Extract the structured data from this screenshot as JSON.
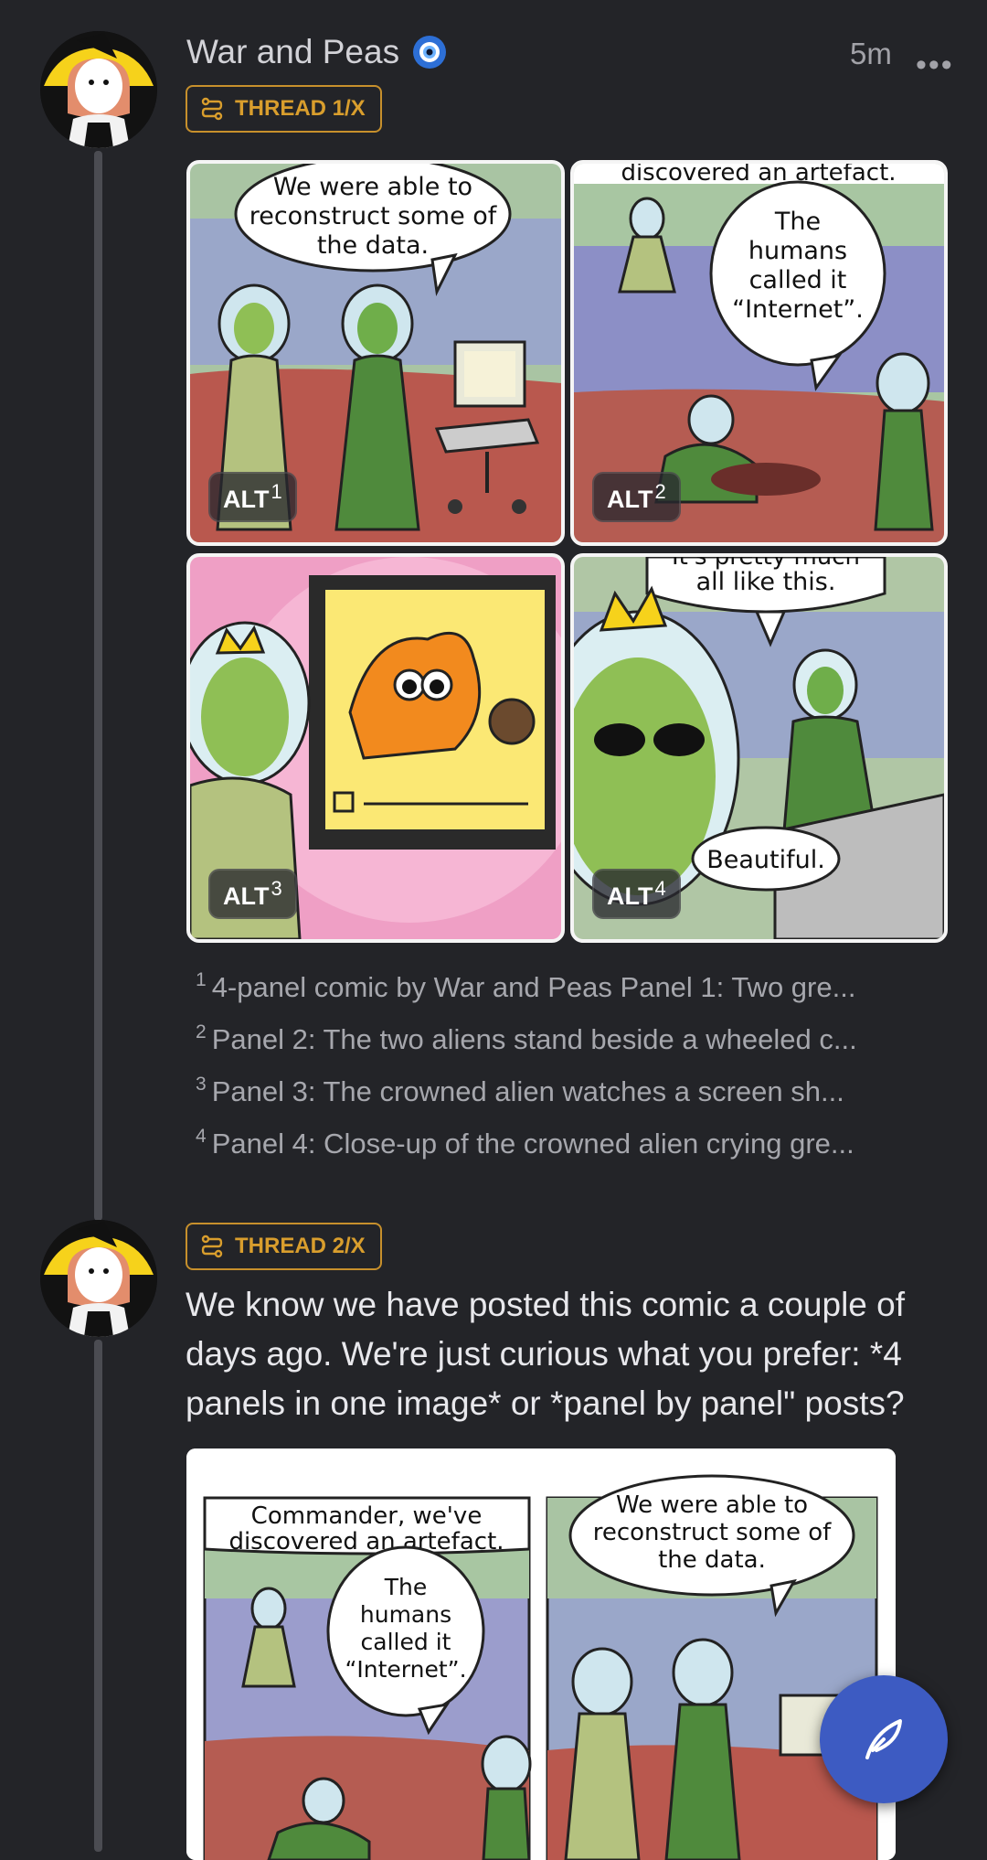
{
  "post1": {
    "author": "War and Peas",
    "time": "5m",
    "more": "•••",
    "thread_label": "THREAD 1/X",
    "alt_label": "ALT",
    "alt_numbers": [
      "1",
      "2",
      "3",
      "4"
    ],
    "panel_texts": {
      "p1": [
        "We were able to",
        "reconstruct some of",
        "the data."
      ],
      "p2_top": "discovered an artefact.",
      "p2": [
        "The",
        "humans",
        "called it",
        "“Internet”."
      ],
      "p4_top": [
        "It's pretty much",
        "all like this."
      ],
      "p4_bubble": "Beautiful."
    },
    "captions": [
      {
        "num": "1",
        "text": "4-panel comic by War and Peas Panel 1: Two gre..."
      },
      {
        "num": "2",
        "text": "Panel 2: The two aliens stand beside a wheeled c..."
      },
      {
        "num": "3",
        "text": "Panel 3: The crowned alien watches a screen sh..."
      },
      {
        "num": "4",
        "text": "Panel 4: Close-up of the crowned alien crying gre..."
      }
    ]
  },
  "post2": {
    "thread_label": "THREAD 2/X",
    "text": "We know we have posted this comic a couple of days ago. We're just curious what you prefer: *4 panels in one image* or *panel by panel\" posts?",
    "comic_texts": {
      "left_top": [
        "Commander, we've",
        "discovered an artefact."
      ],
      "left_bubble": [
        "The",
        "humans",
        "called it",
        "“Internet”."
      ],
      "right_top": [
        "We were able to",
        "reconstruct some of",
        "the data."
      ]
    }
  },
  "icons": {
    "verified": "evil-eye-badge-icon",
    "thread": "thread-icon",
    "compose": "feather-compose-icon",
    "more": "more-icon"
  }
}
